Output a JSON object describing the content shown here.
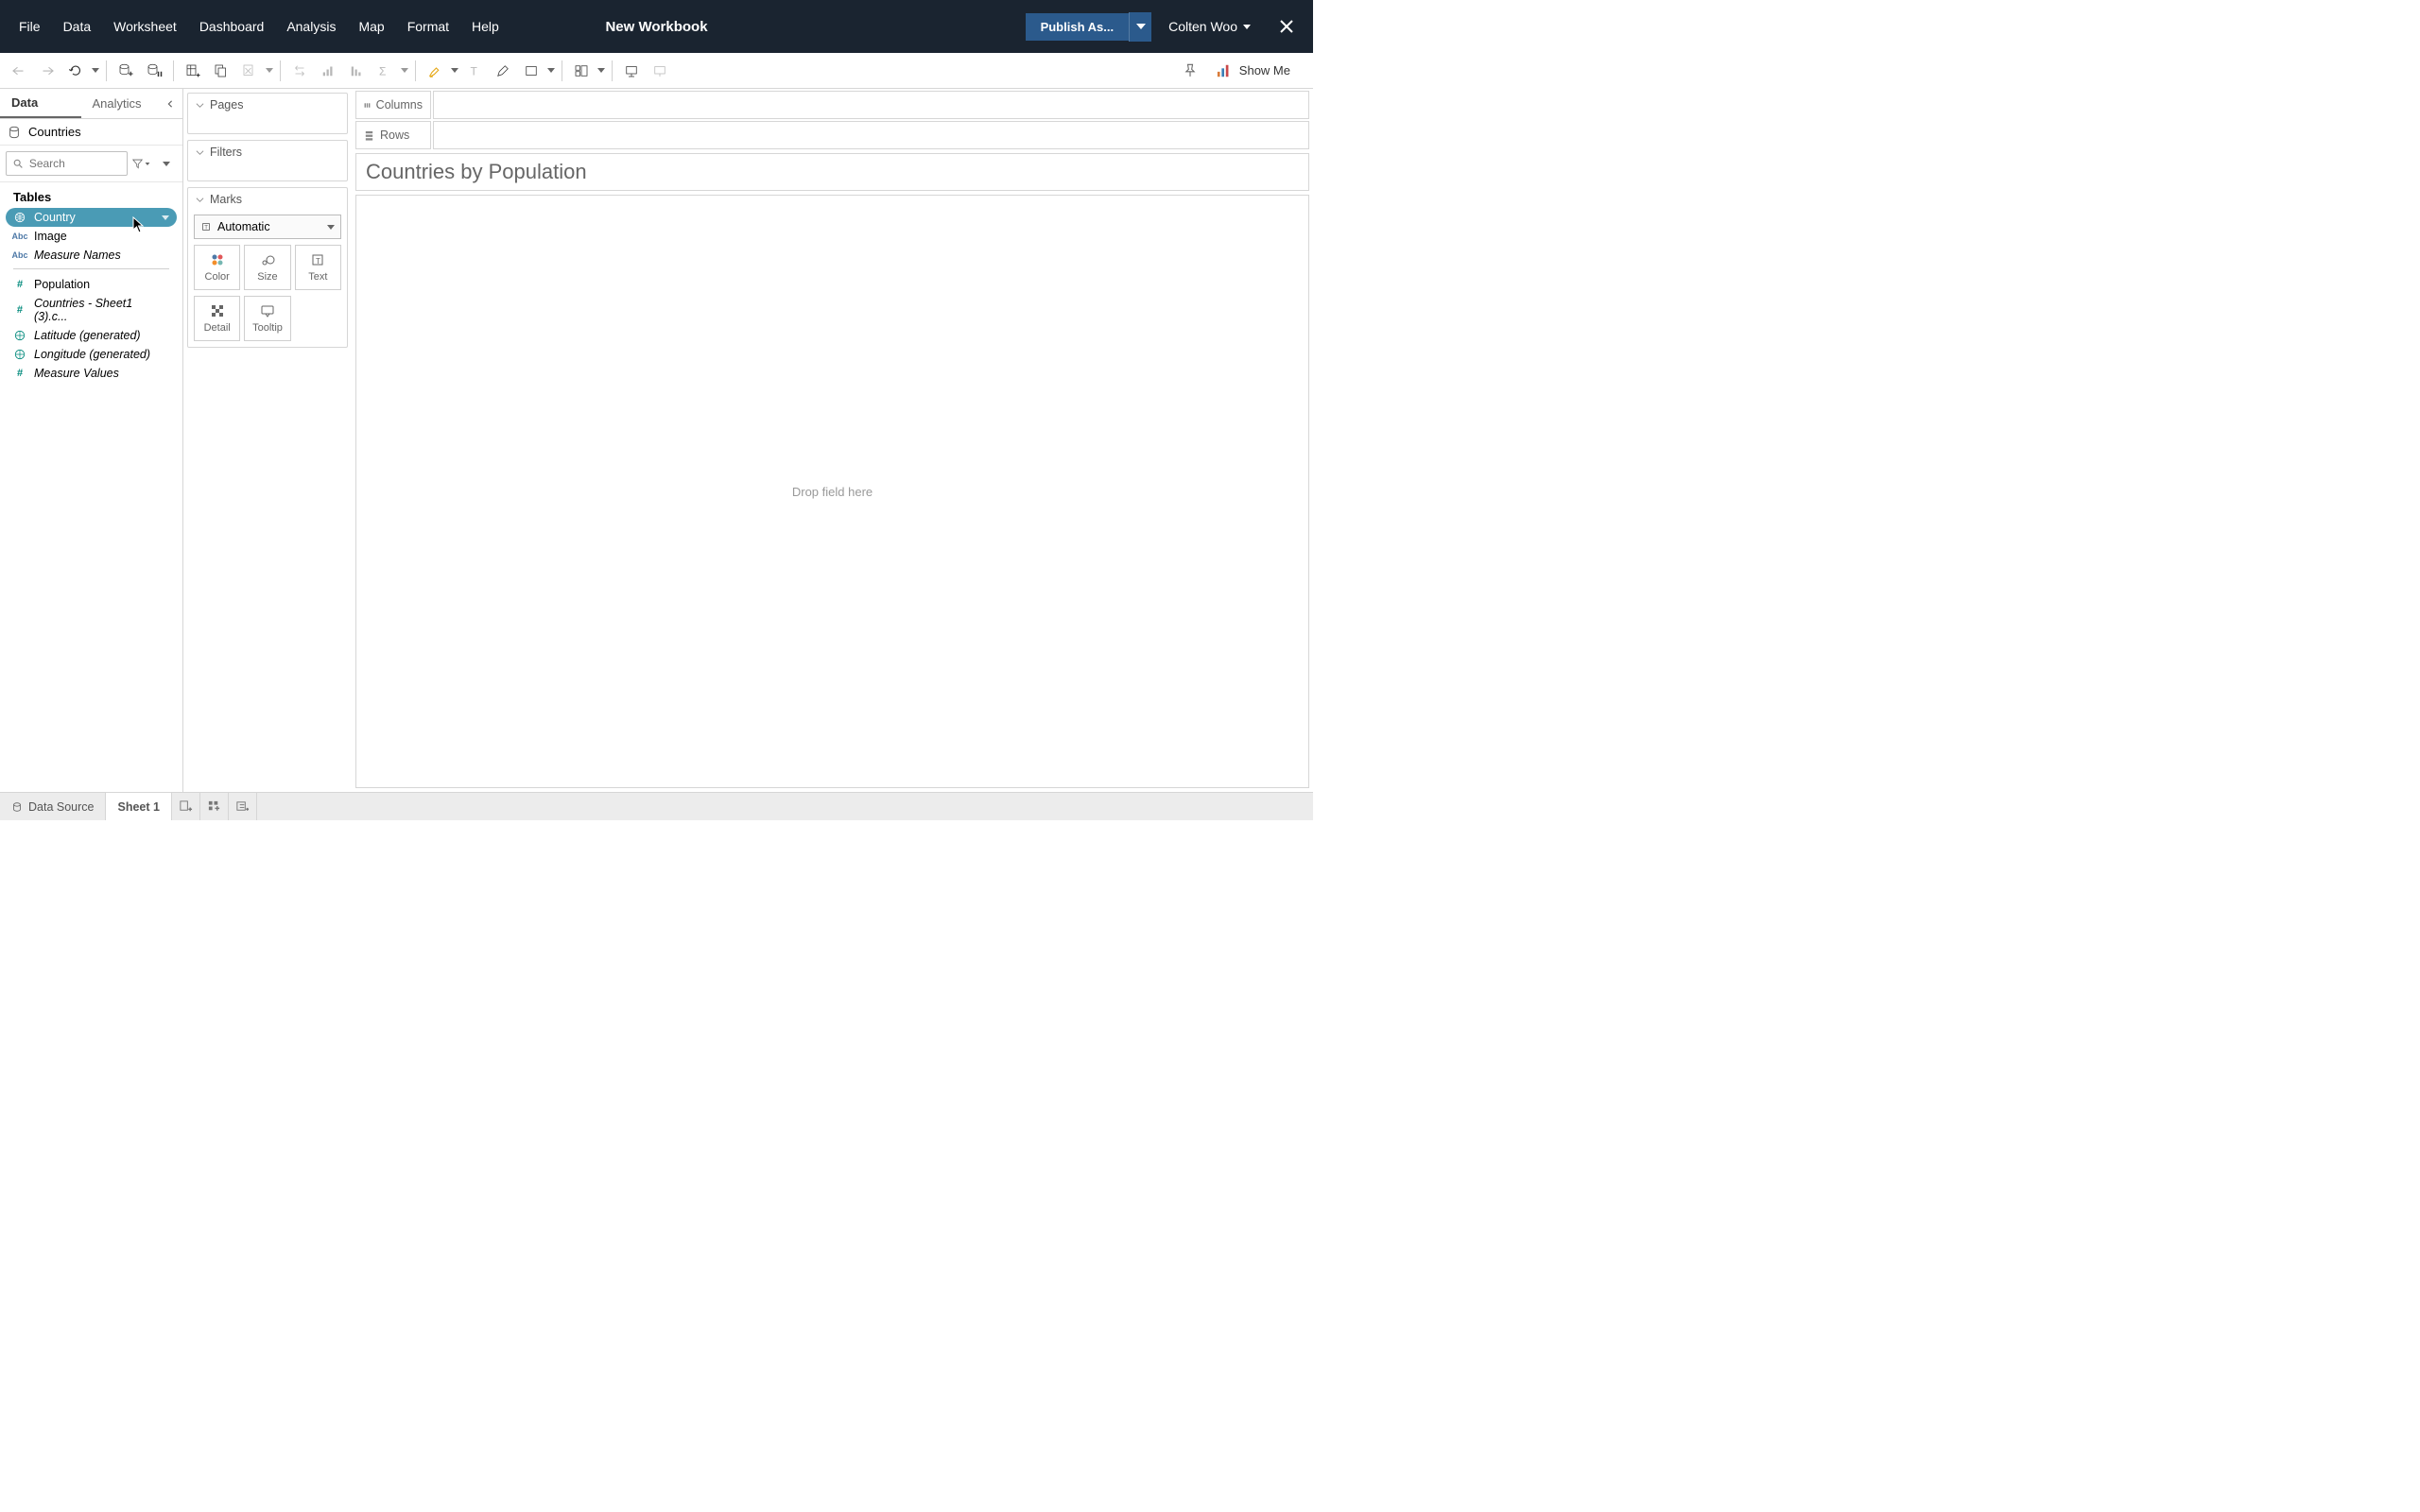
{
  "titlebar": {
    "menus": [
      "File",
      "Data",
      "Worksheet",
      "Dashboard",
      "Analysis",
      "Map",
      "Format",
      "Help"
    ],
    "workbook_title": "New Workbook",
    "publish_label": "Publish As...",
    "user_label": "Colten Woo"
  },
  "toolbar": {
    "showme_label": "Show Me"
  },
  "datapane": {
    "tabs": {
      "data": "Data",
      "analytics": "Analytics"
    },
    "datasource": "Countries",
    "search_placeholder": "Search",
    "tables_header": "Tables",
    "fields": [
      {
        "icon": "globe",
        "color": "blue",
        "name": "Country",
        "selected": true,
        "italic": false
      },
      {
        "icon": "abc",
        "color": "blue",
        "name": "Image",
        "selected": false,
        "italic": false
      },
      {
        "icon": "abc",
        "color": "blue",
        "name": "Measure Names",
        "selected": false,
        "italic": true
      },
      {
        "icon": "hash",
        "color": "green",
        "name": "Population",
        "selected": false,
        "italic": false
      },
      {
        "icon": "hash",
        "color": "green",
        "name": "Countries - Sheet1 (3).c...",
        "selected": false,
        "italic": true
      },
      {
        "icon": "globe",
        "color": "green",
        "name": "Latitude (generated)",
        "selected": false,
        "italic": true
      },
      {
        "icon": "globe",
        "color": "green",
        "name": "Longitude (generated)",
        "selected": false,
        "italic": true
      },
      {
        "icon": "hash",
        "color": "green",
        "name": "Measure Values",
        "selected": false,
        "italic": true
      }
    ]
  },
  "cards": {
    "pages_label": "Pages",
    "filters_label": "Filters",
    "marks_label": "Marks",
    "mark_type": "Automatic",
    "mark_cells": {
      "color": "Color",
      "size": "Size",
      "text": "Text",
      "detail": "Detail",
      "tooltip": "Tooltip"
    }
  },
  "shelves": {
    "columns_label": "Columns",
    "rows_label": "Rows"
  },
  "worksheet": {
    "title": "Countries by Population",
    "drop_hint": "Drop field here"
  },
  "bottom": {
    "data_source": "Data Source",
    "sheet": "Sheet 1"
  }
}
